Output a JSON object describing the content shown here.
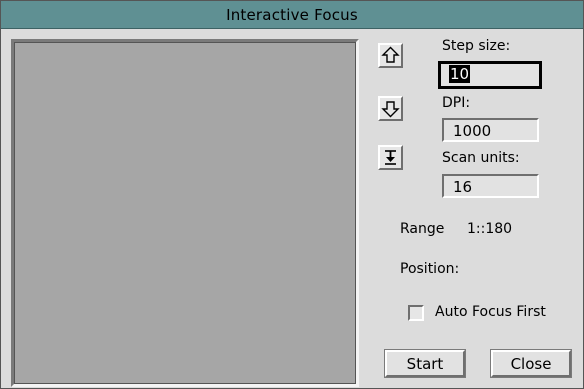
{
  "window": {
    "title": "Interactive Focus"
  },
  "controls": {
    "step_size_label": "Step size:",
    "step_size_value": "10",
    "dpi_label": "DPI:",
    "dpi_value": "1000",
    "scan_units_label": "Scan units:",
    "scan_units_value": "16",
    "range_label": "Range",
    "range_value": "1::180",
    "position_label": "Position:",
    "auto_focus_label": "Auto Focus First",
    "auto_focus_checked": false,
    "start_label": "Start",
    "close_label": "Close"
  },
  "icons": {
    "step_up": "arrow-up-icon",
    "step_down": "arrow-down-icon",
    "go_to_limit": "arrow-to-bottom-icon"
  },
  "colors": {
    "titlebar": "#5f9093",
    "window_bg": "#dcdcdc",
    "preview_bg": "#a6a6a6"
  }
}
